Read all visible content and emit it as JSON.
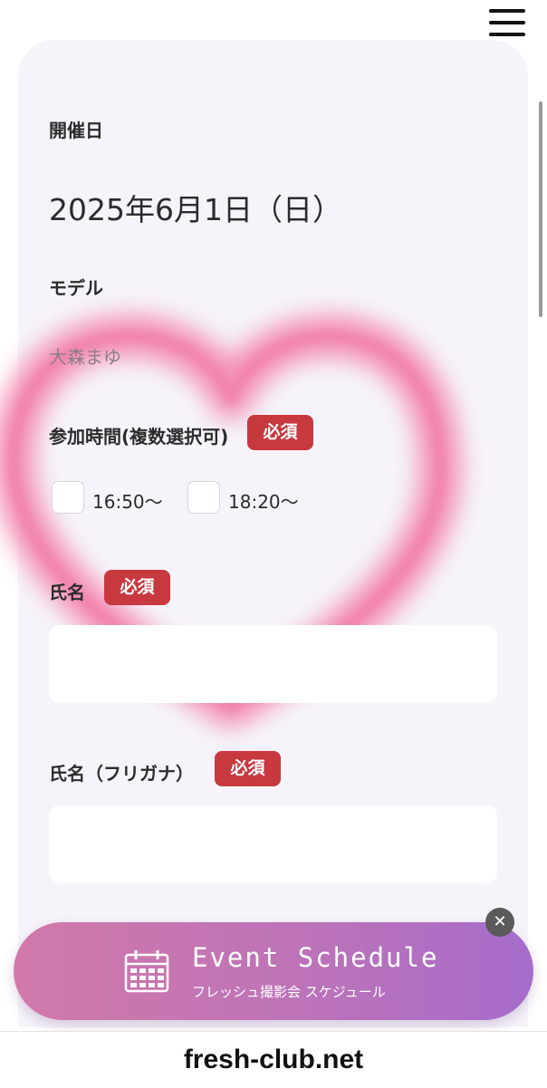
{
  "form": {
    "date_label": "開催日",
    "date_value": "2025年6月1日（日）",
    "model_label": "モデル",
    "model_value": "大森まゆ",
    "time_label": "参加時間(複数選択可)",
    "required": "必須",
    "time_options": [
      "16:50〜",
      "18:20〜"
    ],
    "name_label": "氏名",
    "name_value": "",
    "kana_label": "氏名（フリガナ）",
    "kana_value": ""
  },
  "banner": {
    "title": "Event Schedule",
    "subtitle": "フレッシュ撮影会 スケジュール",
    "icon": "calendar-icon",
    "close_icon": "close-icon"
  },
  "footer": {
    "site": "fresh-club.net"
  },
  "colors": {
    "required_badge": "#c8383f",
    "card_bg": "#f6f4fa",
    "heart": "#f48fb5",
    "banner_start": "#d179a9",
    "banner_end": "#a66ccb"
  }
}
